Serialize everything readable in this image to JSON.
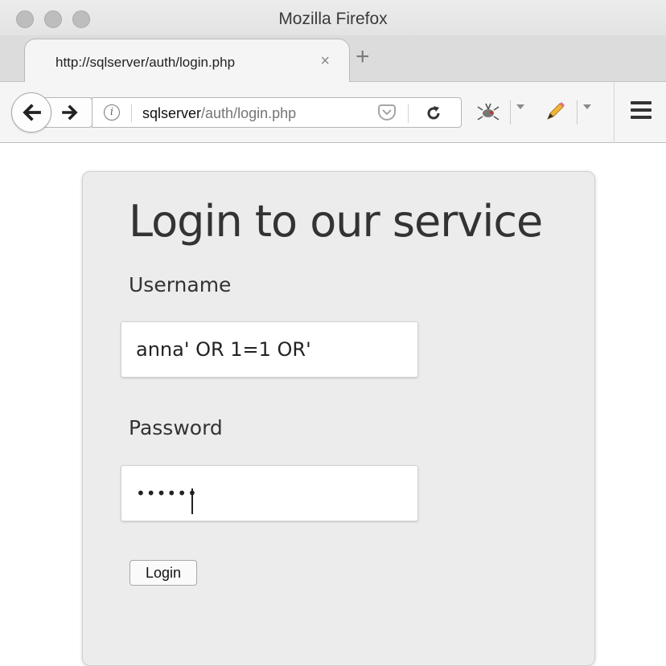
{
  "window": {
    "title": "Mozilla Firefox"
  },
  "tab": {
    "title": "http://sqlserver/auth/login.php",
    "close_glyph": "×",
    "new_tab_glyph": "+"
  },
  "navbar": {
    "back_glyph": "←",
    "forward_glyph": "→",
    "info_glyph": "i",
    "url_host": "sqlserver",
    "url_path": "/auth/login.php",
    "reload_glyph": "↻",
    "addon1_glyph": "🐞",
    "addon2_glyph": "✏️"
  },
  "page": {
    "heading": "Login to our service",
    "username_label": "Username",
    "username_value": "anna' OR 1=1 OR'",
    "password_label": "Password",
    "password_display": "••••••",
    "login_button": "Login"
  },
  "colors": {
    "panel_bg": "#ececec",
    "chrome_bg": "#f5f5f5",
    "text": "#333333"
  },
  "icons": [
    "back-icon",
    "forward-icon",
    "info-icon",
    "pocket-icon",
    "reload-icon",
    "firebug-icon",
    "pencil-icon",
    "hamburger-menu-icon"
  ]
}
